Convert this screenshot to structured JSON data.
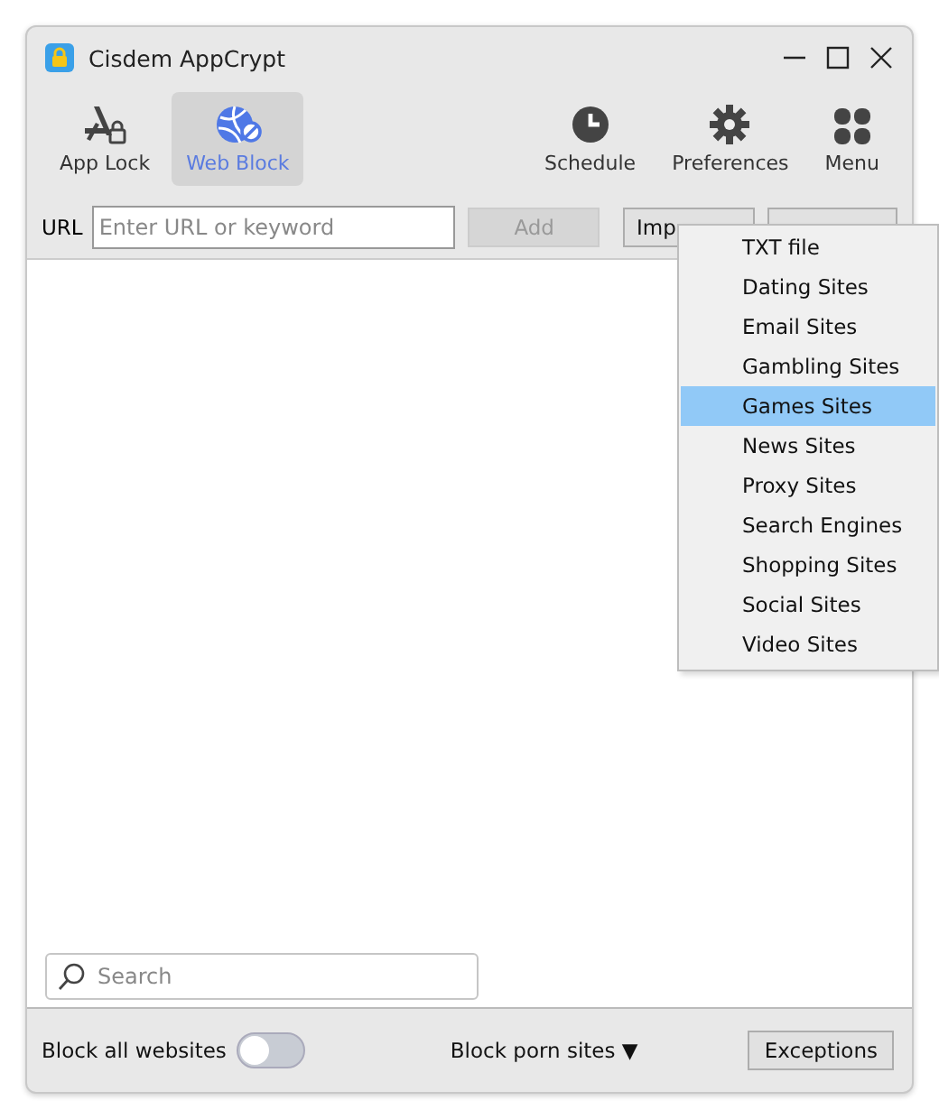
{
  "window": {
    "title": "Cisdem AppCrypt"
  },
  "toolbar": {
    "left": [
      {
        "label": "App Lock",
        "selected": false
      },
      {
        "label": "Web Block",
        "selected": true
      }
    ],
    "right": [
      {
        "label": "Schedule"
      },
      {
        "label": "Preferences"
      },
      {
        "label": "Menu"
      }
    ]
  },
  "url_bar": {
    "label": "URL",
    "placeholder": "Enter URL or keyword",
    "add_button": {
      "label": "Add",
      "disabled": true
    },
    "import_button": {
      "label": "Imp"
    }
  },
  "import_menu": {
    "items": [
      {
        "label": "TXT file",
        "selected": false
      },
      {
        "label": "Dating Sites",
        "selected": false
      },
      {
        "label": "Email Sites",
        "selected": false
      },
      {
        "label": "Gambling Sites",
        "selected": false
      },
      {
        "label": "Games Sites",
        "selected": true
      },
      {
        "label": "News Sites",
        "selected": false
      },
      {
        "label": "Proxy Sites",
        "selected": false
      },
      {
        "label": "Search Engines",
        "selected": false
      },
      {
        "label": "Shopping Sites",
        "selected": false
      },
      {
        "label": "Social Sites",
        "selected": false
      },
      {
        "label": "Video Sites",
        "selected": false
      }
    ]
  },
  "search": {
    "placeholder": "Search"
  },
  "status_bar": {
    "block_all": {
      "label": "Block all websites",
      "on": false
    },
    "block_porn": {
      "label": "Block porn sites",
      "arrow": "▼"
    },
    "exceptions_button": {
      "label": "Exceptions"
    }
  }
}
